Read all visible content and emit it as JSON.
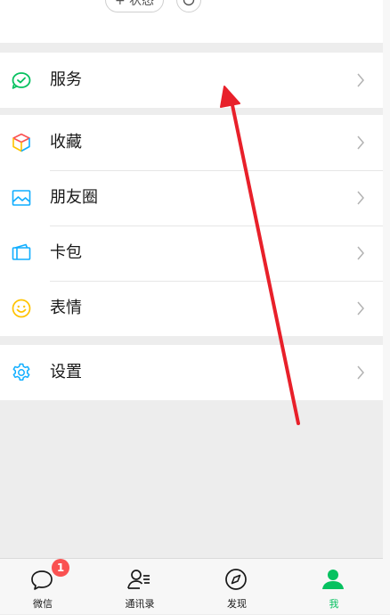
{
  "header": {
    "status_label": "+ 状态"
  },
  "menu": {
    "service": "服务",
    "favorites": "收藏",
    "moments": "朋友圈",
    "cards": "卡包",
    "stickers": "表情",
    "settings": "设置"
  },
  "tabbar": {
    "chats": "微信",
    "chats_badge": "1",
    "contacts": "通讯录",
    "discover": "发现",
    "me": "我"
  },
  "colors": {
    "accent": "#07c160",
    "badge": "#fa5151",
    "annotation_arrow": "#e8202a"
  }
}
